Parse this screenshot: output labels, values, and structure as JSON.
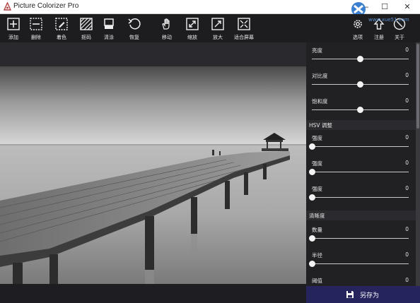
{
  "window": {
    "title": "Picture Colorizer Pro",
    "minimize": "—",
    "maximize": "☐",
    "close": "✕"
  },
  "toolbar": {
    "tools": [
      {
        "label": "添加",
        "icon": "add-icon"
      },
      {
        "label": "删除",
        "icon": "remove-icon"
      },
      {
        "label": "着色",
        "icon": "colorize-icon"
      },
      {
        "label": "抠码",
        "icon": "mask-icon"
      },
      {
        "label": "清涂",
        "icon": "eraser-icon"
      },
      {
        "label": "恢复",
        "icon": "restore-icon"
      },
      {
        "label": "移动",
        "icon": "hand-icon"
      },
      {
        "label": "缩放",
        "icon": "zoom-in-icon"
      },
      {
        "label": "放大",
        "icon": "enlarge-icon"
      },
      {
        "label": "适合屏幕",
        "icon": "fit-screen-icon"
      }
    ],
    "right_tools": [
      {
        "label": "选项",
        "icon": "gear-icon"
      },
      {
        "label": "注册",
        "icon": "register-icon"
      },
      {
        "label": "关于",
        "icon": "info-icon"
      }
    ]
  },
  "panel": {
    "basic": [
      {
        "label": "亮度",
        "value": "0",
        "level": 0.5
      },
      {
        "label": "对比度",
        "value": "0",
        "level": 0.5
      },
      {
        "label": "饱和度",
        "value": "0",
        "level": 0.5
      }
    ],
    "hsv_title": "HSV 调整",
    "hsv": [
      {
        "label": "强度",
        "value": "0",
        "level": 0.0
      },
      {
        "label": "强度",
        "value": "0",
        "level": 0.0
      },
      {
        "label": "强度",
        "value": "0",
        "level": 0.0
      }
    ],
    "sharpen_title": "清晰度",
    "sharpen": [
      {
        "label": "数量",
        "value": "0",
        "level": 0.0
      },
      {
        "label": "半径",
        "value": "0",
        "level": 0.0
      },
      {
        "label": "阈值",
        "value": "0",
        "level": 0.0
      }
    ]
  },
  "save_button": {
    "label": "另存为",
    "icon": "save-icon"
  },
  "watermark": {
    "site": "www.xue51.com"
  },
  "colors": {
    "toolbar_bg": "#1d1d20",
    "panel_bg": "#212124",
    "save_bg": "#25245c",
    "slider_knob": "#f4f4f4"
  }
}
